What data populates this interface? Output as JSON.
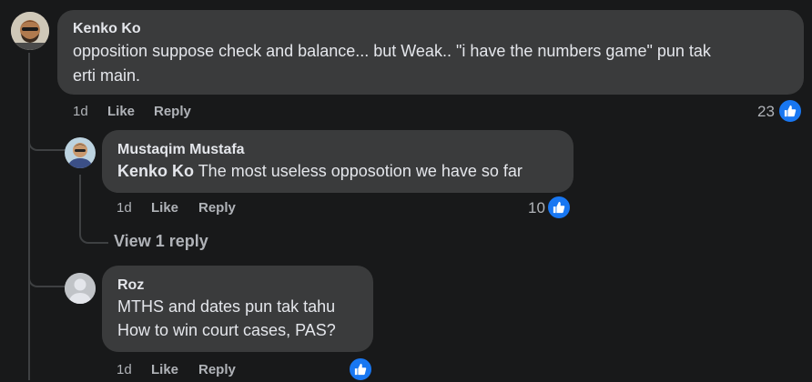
{
  "colors": {
    "background": "#18191a",
    "bubble": "#3a3b3c",
    "like_blue": "#1877f2",
    "muted_text": "#b0b3b8"
  },
  "comments": [
    {
      "author": "Kenko Ko",
      "line1": "opposition suppose check and balance... but Weak.. \"i have the numbers game\" pun tak",
      "line2": "erti main.",
      "time": "1d",
      "like_label": "Like",
      "reply_label": "Reply",
      "reaction_count": "23",
      "reaction_icon": "thumbs-up-icon"
    },
    {
      "author": "Mustaqim Mustafa",
      "mention": "Kenko Ko",
      "text": " The most useless opposotion we have so far",
      "time": "1d",
      "like_label": "Like",
      "reply_label": "Reply",
      "reaction_count": "10",
      "reaction_icon": "thumbs-up-icon",
      "view_replies": "View 1 reply"
    },
    {
      "author": "Roz",
      "line1": "MTHS and dates pun tak tahu",
      "line2": "How to win court cases, PAS?",
      "time": "1d",
      "like_label": "Like",
      "reply_label": "Reply",
      "reaction_icon": "thumbs-up-icon"
    }
  ]
}
